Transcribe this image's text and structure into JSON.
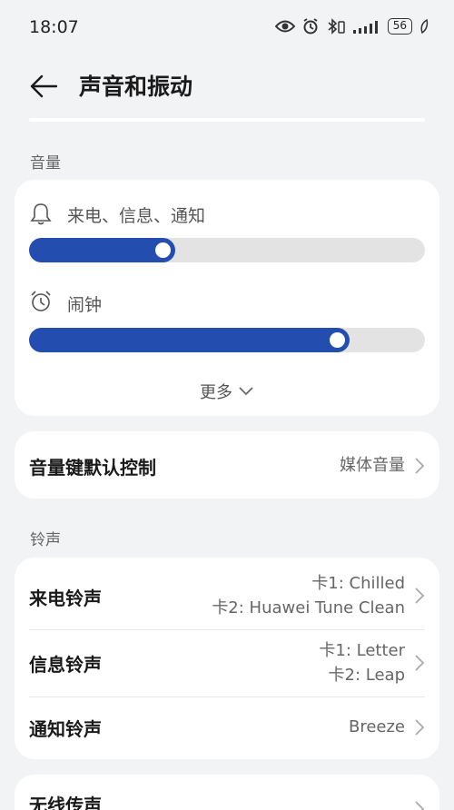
{
  "status_bar": {
    "time": "18:07",
    "battery": "56"
  },
  "header": {
    "title": "声音和振动"
  },
  "volume": {
    "section_label": "音量",
    "ringtone_label": "来电、信息、通知",
    "ringtone_level": 0.37,
    "alarm_label": "闹钟",
    "alarm_level": 0.81,
    "more_label": "更多"
  },
  "volume_key": {
    "title": "音量键默认控制",
    "value": "媒体音量"
  },
  "ringtones": {
    "section_label": "铃声",
    "call": {
      "title": "来电铃声",
      "value_line1": "卡1: Chilled",
      "value_line2": "卡2: Huawei Tune Clean"
    },
    "message": {
      "title": "信息铃声",
      "value_line1": "卡1: Letter",
      "value_line2": "卡2: Leap"
    },
    "notification": {
      "title": "通知铃声",
      "value": "Breeze"
    }
  },
  "wireless": {
    "title": "无线传声"
  },
  "colors": {
    "accent": "#234eb0",
    "background": "#f1f3f5",
    "card": "#ffffff"
  }
}
